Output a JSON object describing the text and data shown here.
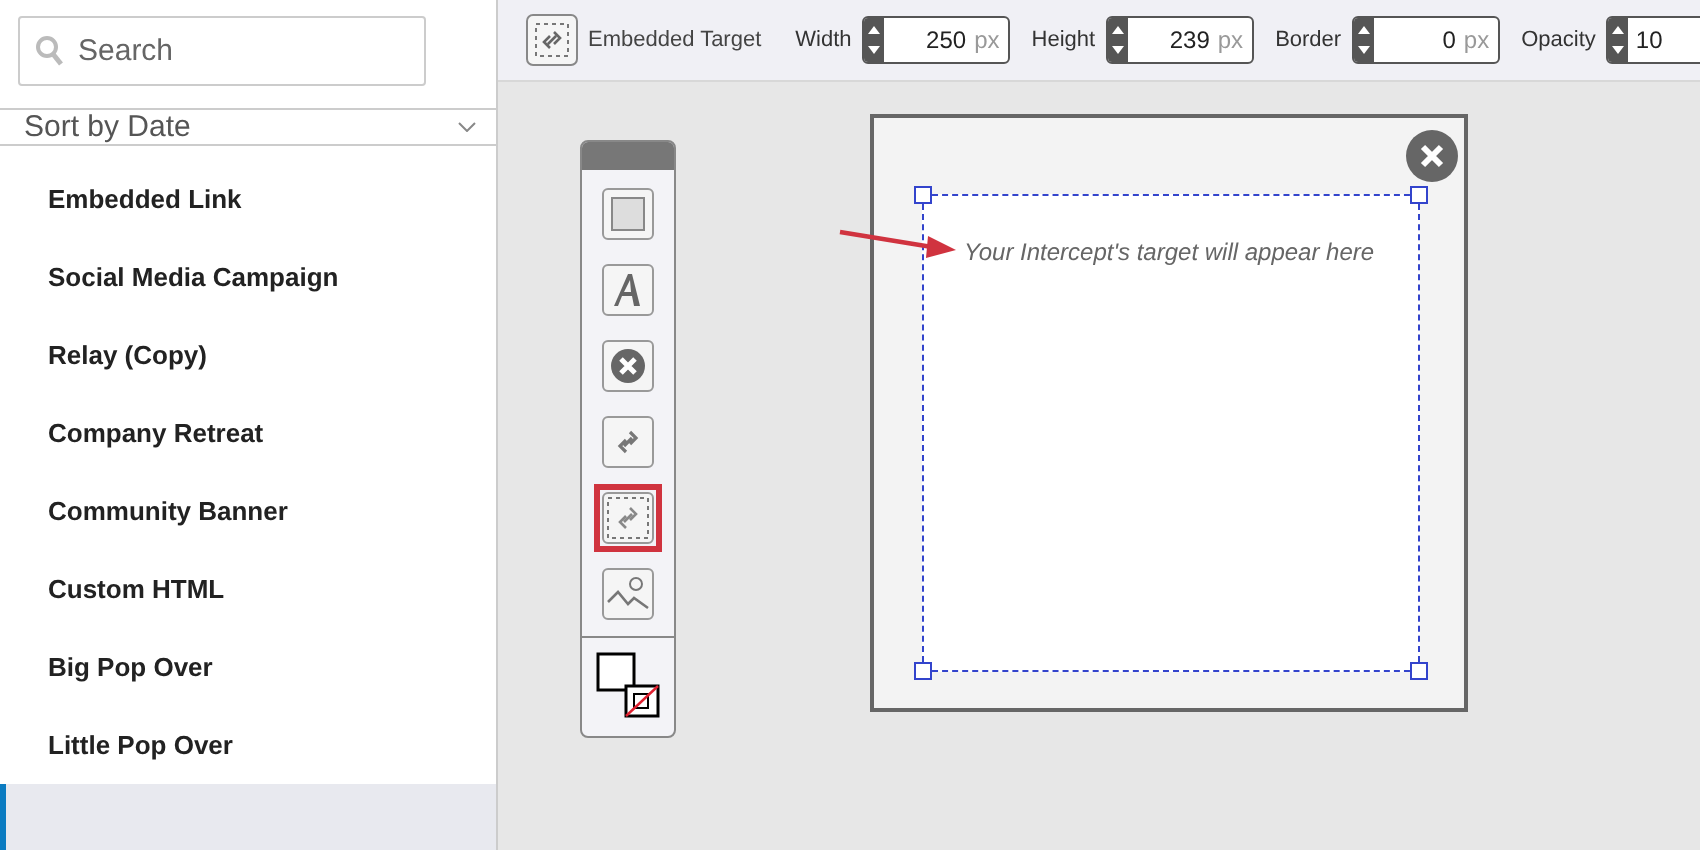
{
  "sidebar": {
    "search": {
      "placeholder": "Search"
    },
    "sort": {
      "label": "Sort by Date"
    },
    "items": [
      {
        "label": "Embedded Link",
        "selected": false
      },
      {
        "label": "Social Media Campaign",
        "selected": false
      },
      {
        "label": "Relay (Copy)",
        "selected": false
      },
      {
        "label": "Company Retreat",
        "selected": false
      },
      {
        "label": "Community Banner",
        "selected": false
      },
      {
        "label": "Custom HTML",
        "selected": false
      },
      {
        "label": "Big Pop Over",
        "selected": false
      },
      {
        "label": "Little Pop Over",
        "selected": false
      },
      {
        "selected": true
      }
    ]
  },
  "toolbar": {
    "element": "Embedded Target",
    "fields": [
      {
        "label": "Width",
        "value": "250",
        "unit": "px"
      },
      {
        "label": "Height",
        "value": "239",
        "unit": "px"
      },
      {
        "label": "Border",
        "value": "0",
        "unit": "px"
      },
      {
        "label": "Opacity",
        "value": "10"
      }
    ]
  },
  "tools": [
    {
      "kind": "rectangle",
      "selected": false
    },
    {
      "kind": "text",
      "selected": false
    },
    {
      "kind": "close",
      "selected": false
    },
    {
      "kind": "link",
      "selected": false
    },
    {
      "kind": "target",
      "selected": true
    },
    {
      "kind": "image",
      "selected": false
    }
  ],
  "canvas": {
    "target_text": "Your Intercept's target will appear here"
  }
}
